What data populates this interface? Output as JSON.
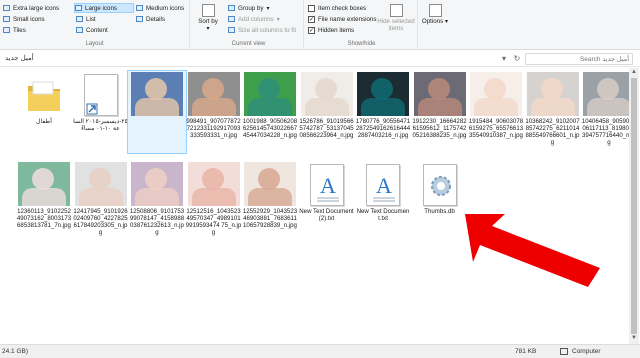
{
  "ribbon": {
    "layout": {
      "label": "Layout",
      "items": [
        "Extra large icons",
        "Large icons",
        "Medium icons",
        "Small icons",
        "List",
        "Details",
        "Tiles",
        "Content"
      ],
      "selected": "Large icons"
    },
    "current_view": {
      "label": "Current view",
      "sort_by": "Sort by",
      "group_by": "Group by",
      "add_columns": "Add columns",
      "size_columns": "Size all columns to fit"
    },
    "show_hide": {
      "label": "Show/hide",
      "item_check_boxes": "Item check boxes",
      "file_name_extensions": "File name extensions",
      "hidden_items": "Hidden items",
      "hide_selected": "Hide selected items",
      "checks": {
        "item_check_boxes": false,
        "file_name_extensions": true,
        "hidden_items": true
      }
    },
    "options": {
      "label": "Options"
    }
  },
  "address": {
    "path": "أميل جديد",
    "search_placeholder": "أميل جديد Search"
  },
  "files_row1": [
    {
      "name": "أطفال",
      "kind": "folder"
    },
    {
      "name": "٢٥-ديسمبر-٢٠١٥ الساعة ١٠-٠١ مساءً",
      "kind": "shortcut"
    },
    {
      "name": "3711_90708254270766_8704114710804161727_n.jpg",
      "kind": "photo",
      "selected": true,
      "c1": "#e8c7a8",
      "c2": "#5b7fb5"
    },
    {
      "name": "998491_9070778727212331192917093333593331_n.jpg",
      "kind": "photo",
      "c1": "#d9a98a",
      "c2": "#8f8f8f"
    },
    {
      "name": "1001988_90506208625614574302266745447034228_n.jpg",
      "kind": "photo",
      "c1": "#2e8f7a",
      "c2": "#3e9e4b"
    },
    {
      "name": "1526786_910195665742787_5313704508566223964_n.jpg",
      "kind": "photo",
      "c1": "#e3d8cc",
      "c2": "#f0ece8"
    },
    {
      "name": "1780776_9055647128725491626164442887403216_n.jpg",
      "kind": "photo",
      "c1": "#0f6b73",
      "c2": "#1c2c33"
    },
    {
      "name": "1912230_1666428261595612_117574205216388235_n.jpg",
      "kind": "photo",
      "c1": "#b98a7a",
      "c2": "#6c6a74"
    },
    {
      "name": "1915484_906030786159275_6557661335540910387_n.jpg",
      "kind": "photo",
      "c1": "#f2d7c9",
      "c2": "#f6eee9"
    },
    {
      "name": "10368242_910200785742275_6211014885549766601_n.jpg",
      "kind": "photo",
      "c1": "#f4d9c8",
      "c2": "#d5d2d0"
    },
    {
      "name": "10406458_905906406117113_8198023394757716440_n.jpg",
      "kind": "photo",
      "c1": "#d7ccc4",
      "c2": "#9aa2a8"
    }
  ],
  "files_row2": [
    {
      "name": "12360113_910225249073162_80031736853813781_7n.jpg",
      "kind": "photo",
      "c1": "#f0dde0",
      "c2": "#7fb99d"
    },
    {
      "name": "12417945_910192602409760_4227825617849203305_n.jpg",
      "kind": "photo",
      "c1": "#e8cfc3",
      "c2": "#e1e1e1"
    },
    {
      "name": "12508806_910175399078147_4158988038761232613_n.jpg",
      "kind": "photo",
      "c1": "#efd0c3",
      "c2": "#c9b6cc"
    },
    {
      "name": "12512516_104352349570347_49891019919593474 75_n.jpg",
      "kind": "photo",
      "c1": "#e8b4a6",
      "c2": "#f2ddd8"
    },
    {
      "name": "12552929_104352346903881_768361110657928839_n.jpg",
      "kind": "photo",
      "c1": "#d7a792",
      "c2": "#f0e6e0"
    },
    {
      "name": "New Text Document (2).txt",
      "kind": "text"
    },
    {
      "name": "New Text Document.txt",
      "kind": "text"
    },
    {
      "name": "Thumbs.db",
      "kind": "db"
    }
  ],
  "status": {
    "left": "24.1 GB)",
    "size": "781 KB",
    "location": "Computer"
  },
  "colors": {
    "arrow": "#ee0000",
    "accent": "#0078d7"
  }
}
